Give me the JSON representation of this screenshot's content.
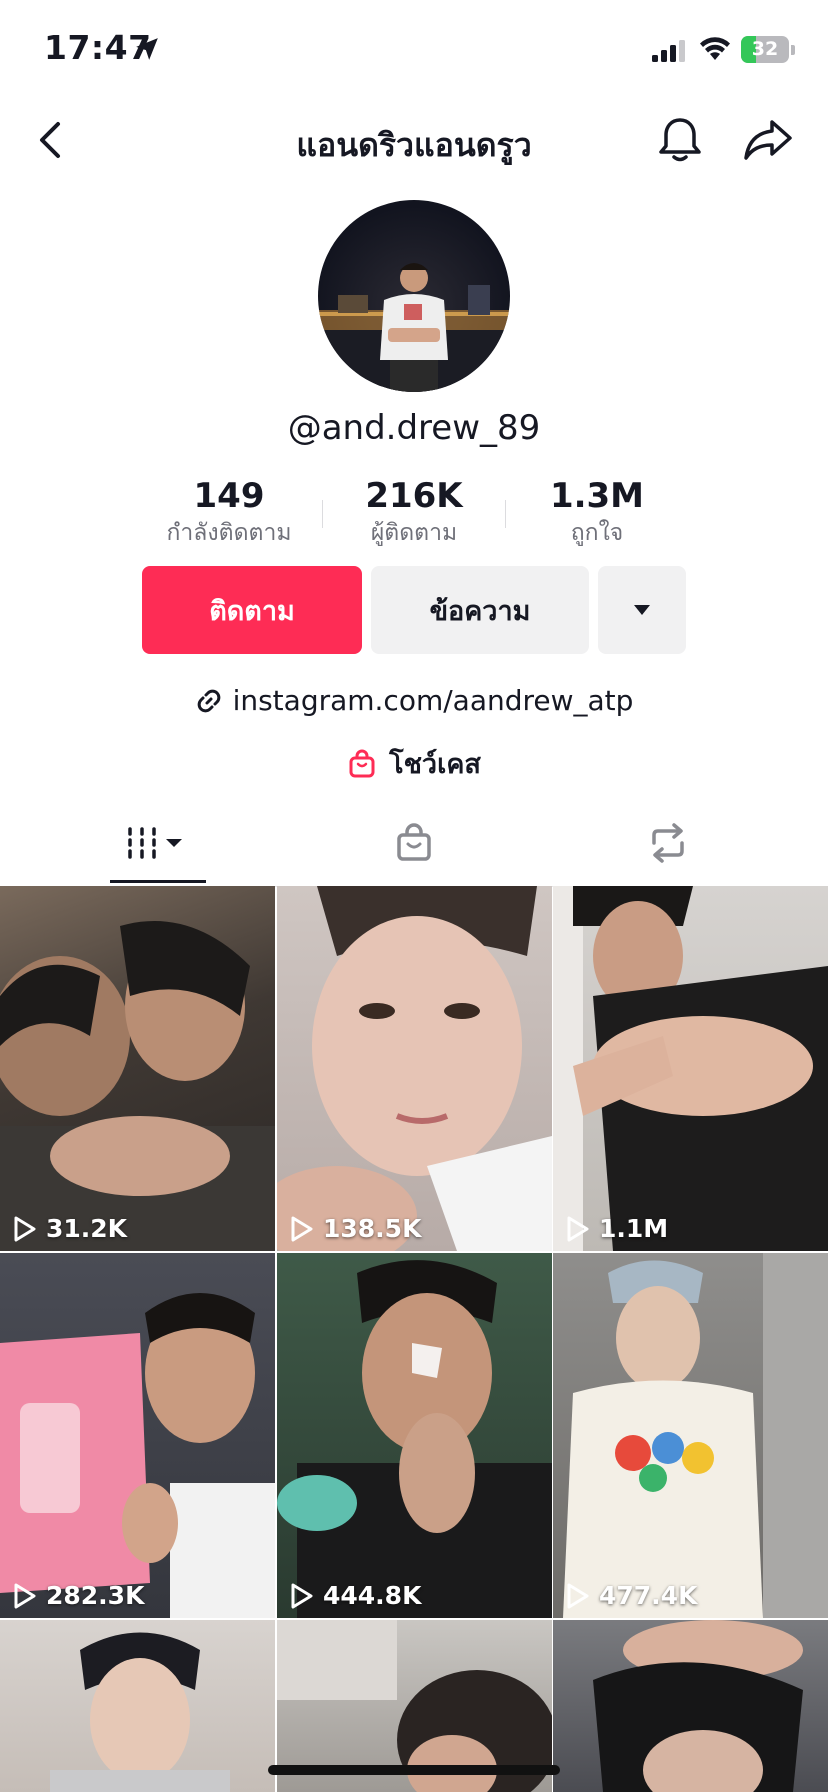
{
  "status_bar": {
    "time": "17:47",
    "battery": "32",
    "battery_level": 0.32
  },
  "header": {
    "title": "แอนดริวแอนดรูว"
  },
  "profile": {
    "username": "@and.drew_89"
  },
  "stats": [
    {
      "value": "149",
      "label": "กำลังติดตาม"
    },
    {
      "value": "216K",
      "label": "ผู้ติดตาม"
    },
    {
      "value": "1.3M",
      "label": "ถูกใจ"
    }
  ],
  "actions": {
    "follow_label": "ติดตาม",
    "message_label": "ข้อความ"
  },
  "bio": {
    "link": "instagram.com/aandrew_atp",
    "showcase_label": "โชว์เคส"
  },
  "colors": {
    "accent": "#fe2c55",
    "text": "#161823",
    "secondary_text": "#6f7079",
    "button_bg": "#f1f1f2"
  },
  "tabs": [
    {
      "icon": "grid-icon",
      "selected": true
    },
    {
      "icon": "shopping-bag-icon",
      "selected": false
    },
    {
      "icon": "repost-icon",
      "selected": false
    }
  ],
  "videos": [
    {
      "views": "31.2K"
    },
    {
      "views": "138.5K"
    },
    {
      "views": "1.1M"
    },
    {
      "views": "282.3K"
    },
    {
      "views": "444.8K"
    },
    {
      "views": "477.4K"
    },
    {
      "views": ""
    },
    {
      "views": ""
    },
    {
      "views": ""
    }
  ]
}
